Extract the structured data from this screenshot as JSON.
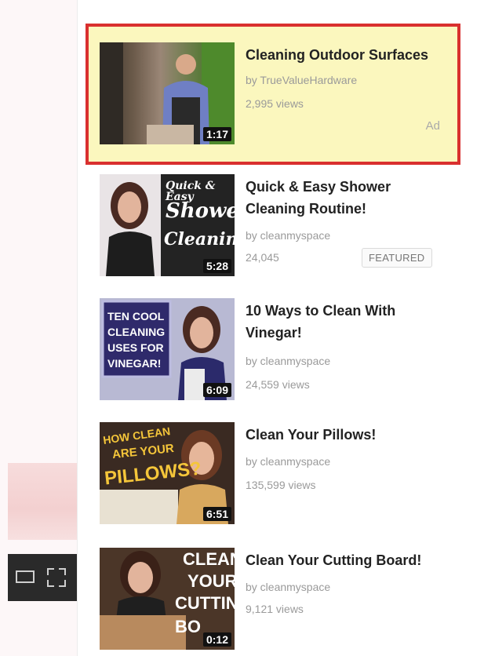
{
  "sidebar": {
    "ad": {
      "title": "Cleaning Outdoor Surfaces",
      "channel": "by TrueValueHardware",
      "views": "2,995 views",
      "duration": "1:17",
      "ad_label": "Ad"
    },
    "videos": [
      {
        "title_line1": "Quick & Easy Shower",
        "title_line2": "Cleaning Routine!",
        "channel": "by cleanmyspace",
        "views": "24,045",
        "duration": "5:28",
        "badge": "FEATURED",
        "thumb_text": [
          "Quick & Easy",
          "Shower",
          "Cleaning"
        ]
      },
      {
        "title_line1": "10 Ways to Clean With",
        "title_line2": "Vinegar!",
        "channel": "by cleanmyspace",
        "views": "24,559 views",
        "duration": "6:09",
        "thumb_text": [
          "TEN COOL",
          "CLEANING",
          "USES FOR",
          "VINEGAR!"
        ]
      },
      {
        "title_line1": "Clean Your Pillows!",
        "channel": "by cleanmyspace",
        "views": "135,599 views",
        "duration": "6:51",
        "thumb_text": [
          "HOW CLEAN",
          "ARE YOUR",
          "PILLOWS?"
        ]
      },
      {
        "title_line1": "Clean Your Cutting Board!",
        "channel": "by cleanmyspace",
        "views": "9,121 views",
        "duration": "0:12",
        "thumb_text": [
          "CLEAN",
          "YOUR",
          "CUTTING",
          "BO"
        ]
      }
    ]
  },
  "colors": {
    "ad_highlight_border": "#d9302f",
    "ad_background": "#fbf7be"
  },
  "icons": {
    "player_theater": "theater-mode-icon",
    "player_fullscreen": "fullscreen-icon"
  }
}
